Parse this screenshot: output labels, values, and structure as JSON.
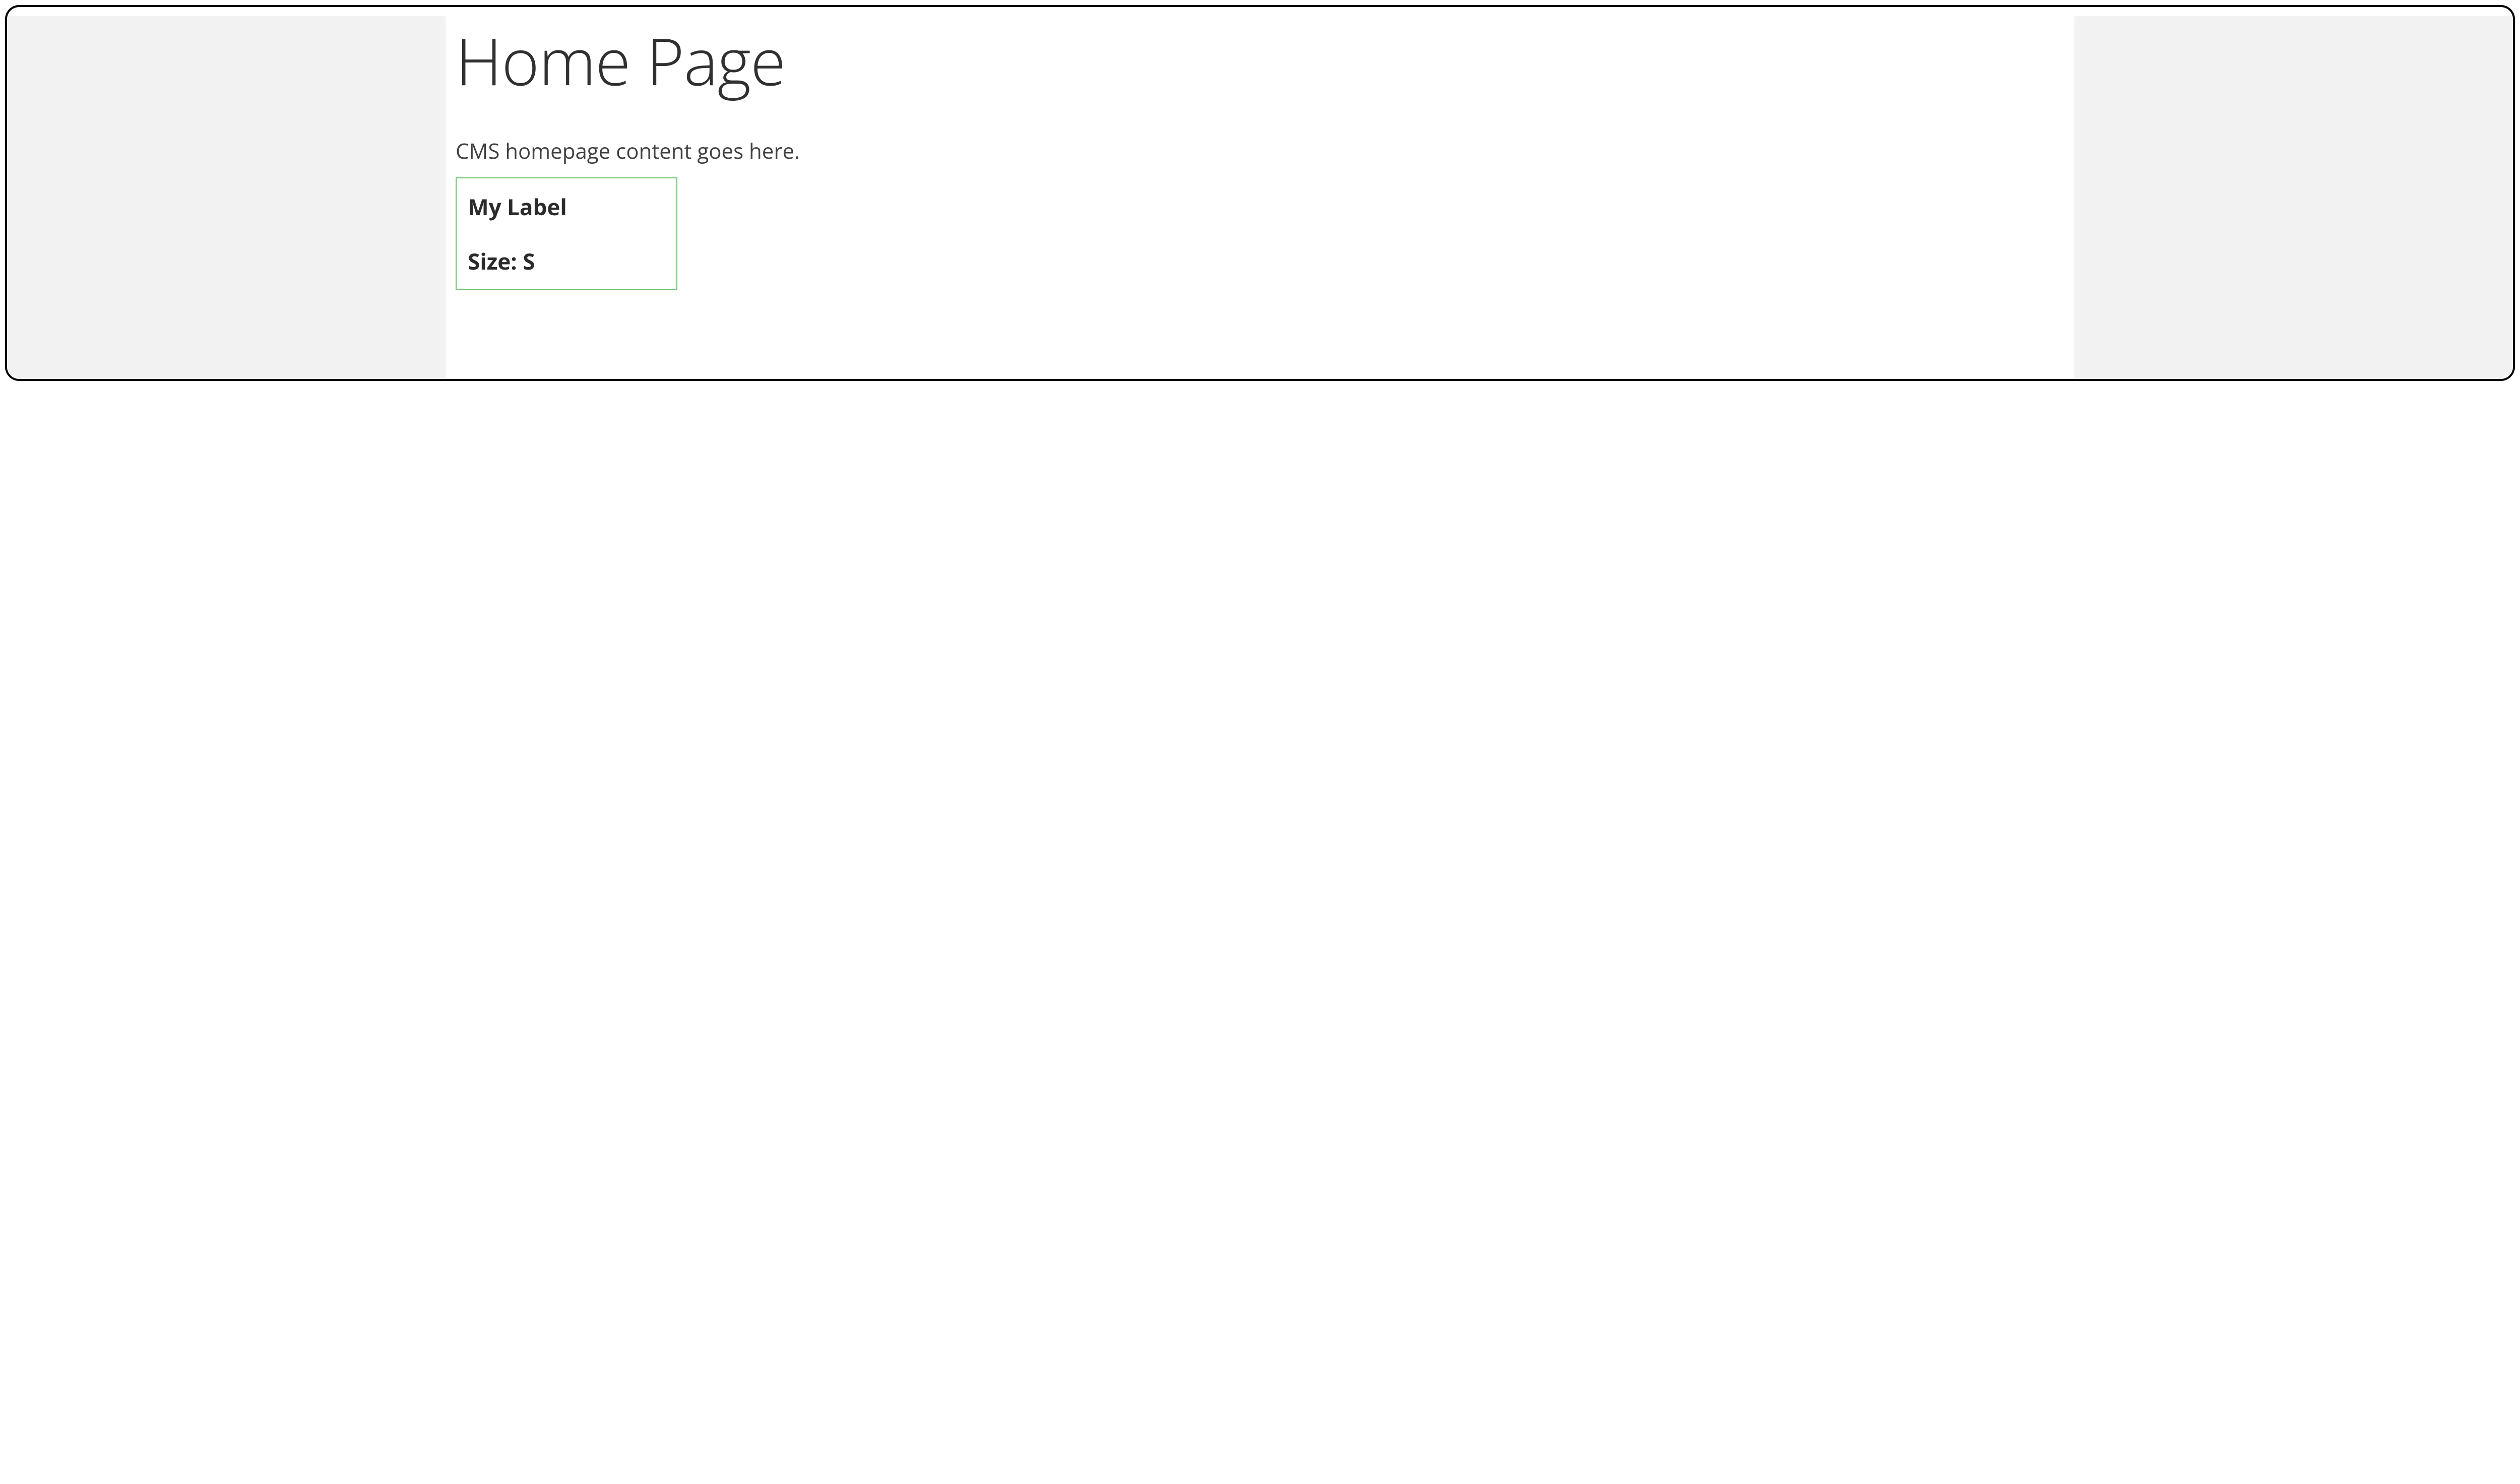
{
  "page": {
    "title": "Home Page",
    "description": "CMS homepage content goes here."
  },
  "widget": {
    "label": "My Label",
    "size_line": "Size: S"
  },
  "colors": {
    "widget_border": "#6ec171"
  }
}
